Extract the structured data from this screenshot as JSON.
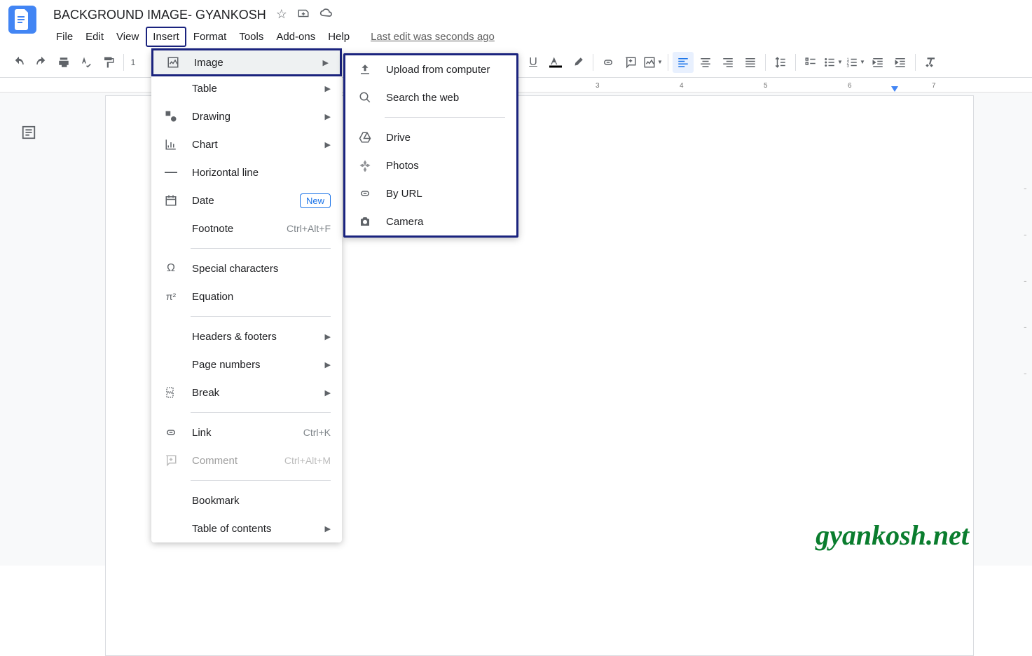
{
  "header": {
    "title": "BACKGROUND IMAGE- GYANKOSH",
    "lastEdit": "Last edit was seconds ago"
  },
  "menubar": {
    "items": [
      "File",
      "Edit",
      "View",
      "Insert",
      "Format",
      "Tools",
      "Add-ons",
      "Help"
    ],
    "activeIndex": 3
  },
  "insertMenu": {
    "image": "Image",
    "table": "Table",
    "drawing": "Drawing",
    "chart": "Chart",
    "hline": "Horizontal line",
    "date": "Date",
    "dateBadge": "New",
    "footnote": "Footnote",
    "footnoteShortcut": "Ctrl+Alt+F",
    "special": "Special characters",
    "equation": "Equation",
    "headers": "Headers & footers",
    "pagenum": "Page numbers",
    "break": "Break",
    "link": "Link",
    "linkShortcut": "Ctrl+K",
    "comment": "Comment",
    "commentShortcut": "Ctrl+Alt+M",
    "bookmark": "Bookmark",
    "toc": "Table of contents"
  },
  "imageSubmenu": {
    "upload": "Upload from computer",
    "search": "Search the web",
    "drive": "Drive",
    "photos": "Photos",
    "url": "By URL",
    "camera": "Camera"
  },
  "ruler": [
    "3",
    "4",
    "5",
    "6",
    "7"
  ],
  "watermark": "gyankosh.net"
}
